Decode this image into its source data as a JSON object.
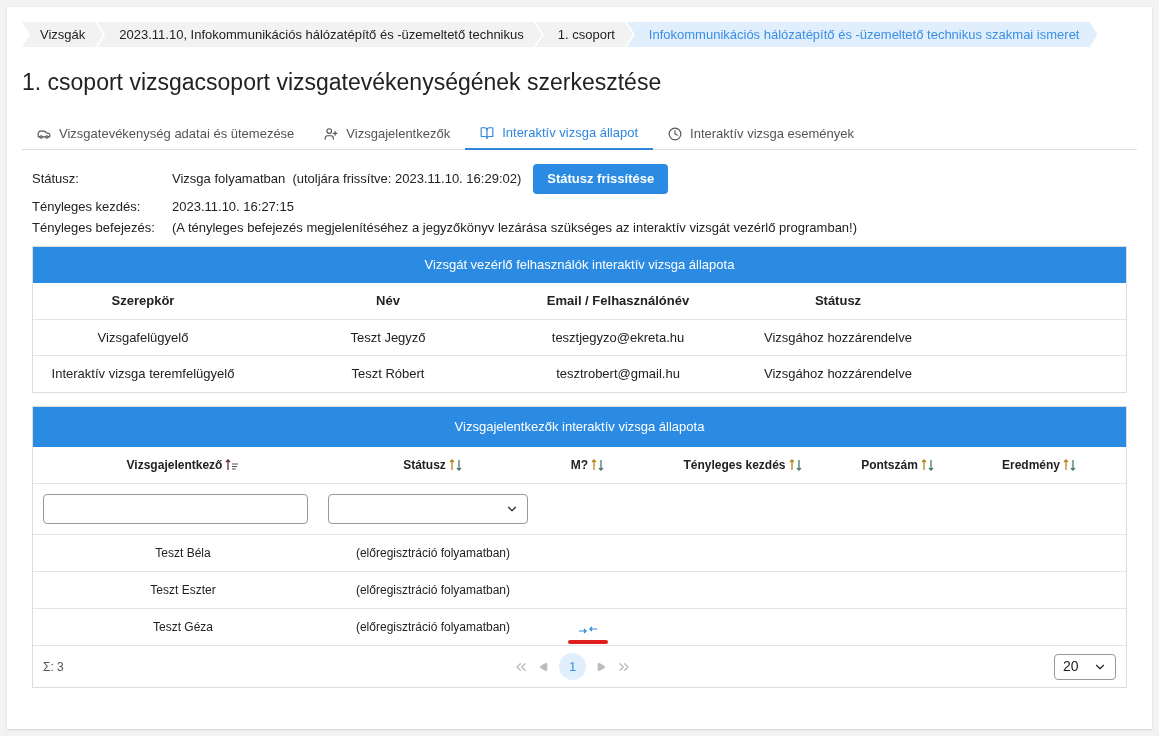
{
  "breadcrumbs": [
    {
      "label": "Vizsgák",
      "selected": false
    },
    {
      "label": "2023.11.10, Infokommunikációs hálózatépítő és -üzemeltető technikus",
      "selected": false
    },
    {
      "label": "1. csoport",
      "selected": false
    },
    {
      "label": "Infokommunikációs hálózatépítő és -üzemeltető technikus szakmai ismeret",
      "selected": true
    }
  ],
  "title": "1. csoport vizsgacsoport vizsgatevékenységének szerkesztése",
  "tabs": [
    {
      "label": "Vizsgatevékenység adatai és ütemezése",
      "selected": false
    },
    {
      "label": "Vizsgajelentkezők",
      "selected": false
    },
    {
      "label": "Interaktív vizsga állapot",
      "selected": true
    },
    {
      "label": "Interaktív vizsga események",
      "selected": false
    }
  ],
  "info": [
    {
      "label": "Státusz:",
      "value": "Vizsga folyamatban  (utoljára frissítve: 2023.11.10. 16:29:02)",
      "button": "Státusz frissítése"
    },
    {
      "label": "Tényleges kezdés:",
      "value": "2023.11.10. 16:27:15"
    },
    {
      "label": "Tényleges befejezés:",
      "value": "(A tényleges befejezés megjelenítéséhez a jegyzőkönyv lezárása szükséges az interaktív vizsgát vezérlő programban!)"
    }
  ],
  "controllers": {
    "title": "Vizsgát vezérlő felhasználók interaktív vizsga állapota",
    "columns": [
      "Szerepkör",
      "Név",
      "Email / Felhasználónév",
      "Státusz"
    ],
    "rows": [
      [
        "Vizsgafelügyelő",
        "Teszt Jegyző",
        "tesztjegyzo@ekreta.hu",
        "Vizsgához hozzárendelve"
      ],
      [
        "Interaktív vizsga teremfelügyelő",
        "Teszt Róbert",
        "tesztrobert@gmail.hu",
        "Vizsgához hozzárendelve"
      ]
    ]
  },
  "candidates": {
    "title": "Vizsgajelentkezők interaktív vizsga állapota",
    "columns": [
      {
        "label": "Vizsgajelentkező",
        "sorted": true
      },
      {
        "label": "Státusz",
        "sorted": false
      },
      {
        "label": "M?",
        "sorted": false
      },
      {
        "label": "Tényleges kezdés",
        "sorted": false
      },
      {
        "label": "Pontszám",
        "sorted": false
      },
      {
        "label": "Eredmény",
        "sorted": false
      }
    ],
    "rows": [
      {
        "name": "Teszt Béla",
        "status": "(előregisztráció folyamatban)",
        "m_flag": false
      },
      {
        "name": "Teszt Eszter",
        "status": "(előregisztráció folyamatban)",
        "m_flag": false
      },
      {
        "name": "Teszt Géza",
        "status": "(előregisztráció folyamatban)",
        "m_flag": true
      }
    ],
    "total": "Σ: 3",
    "pages": [
      {
        "label": "1",
        "selected": true
      }
    ],
    "page_size": "20"
  }
}
